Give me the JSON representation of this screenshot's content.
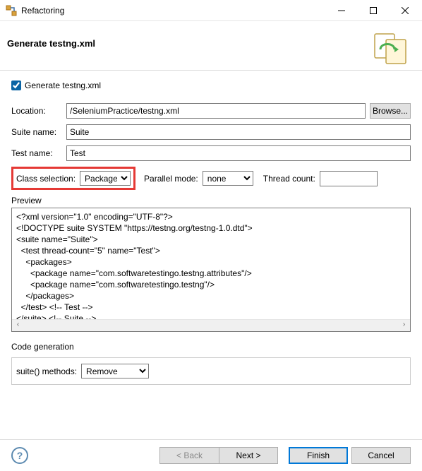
{
  "titlebar": {
    "title": "Refactoring"
  },
  "header": {
    "title": "Generate testng.xml"
  },
  "checkbox": {
    "label": "Generate testng.xml",
    "checked": true
  },
  "form": {
    "location_label": "Location:",
    "location_value": "/SeleniumPractice/testng.xml",
    "browse_label": "Browse...",
    "suite_label": "Suite name:",
    "suite_value": "Suite",
    "test_label": "Test name:",
    "test_value": "Test",
    "class_sel_label": "Class selection:",
    "class_sel_value": "Packages",
    "parallel_label": "Parallel mode:",
    "parallel_value": "none",
    "thread_label": "Thread count:",
    "thread_value": ""
  },
  "preview": {
    "label": "Preview",
    "content": "<?xml version=\"1.0\" encoding=\"UTF-8\"?>\n<!DOCTYPE suite SYSTEM \"https://testng.org/testng-1.0.dtd\">\n<suite name=\"Suite\">\n  <test thread-count=\"5\" name=\"Test\">\n    <packages>\n      <package name=\"com.softwaretestingo.testng.attributes\"/>\n      <package name=\"com.softwaretestingo.testng\"/>\n    </packages>\n  </test> <!-- Test -->\n</suite> <!-- Suite -->"
  },
  "codegen": {
    "heading": "Code generation",
    "suite_methods_label": "suite() methods:",
    "suite_methods_value": "Remove"
  },
  "footer": {
    "back": "< Back",
    "next": "Next >",
    "finish": "Finish",
    "cancel": "Cancel"
  }
}
